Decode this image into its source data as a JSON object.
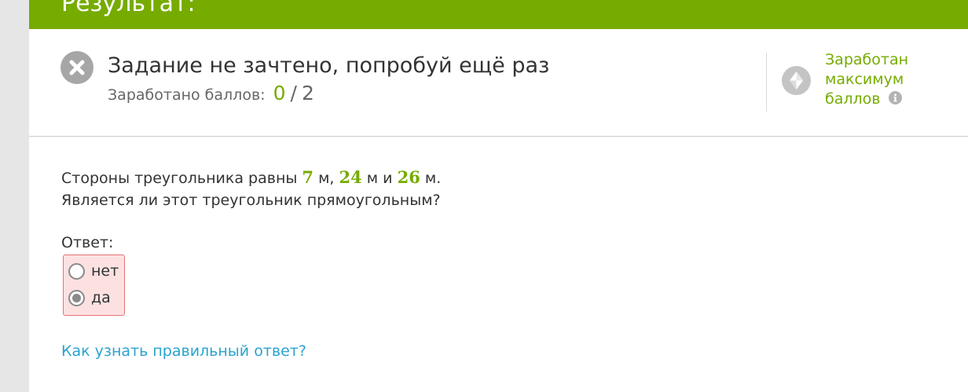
{
  "header": {
    "title": "Результат:"
  },
  "result": {
    "status_text": "Задание не зачтено, попробуй ещё раз",
    "score_label": "Заработано баллов:",
    "score_earned": "0",
    "score_separator": "/",
    "score_total": "2",
    "status_icon": "close-icon",
    "max_points": {
      "line1": "Заработан",
      "line2": "максимум",
      "line3": "баллов",
      "icon": "diamond-icon",
      "info_icon": "info-icon"
    }
  },
  "question": {
    "prefix": "Стороны треугольника равны",
    "side_a": "7",
    "unit_a": "м,",
    "side_b": "24",
    "unit_b": "м и",
    "side_c": "26",
    "unit_c": "м.",
    "line2": "Является ли этот треугольник прямоугольным?"
  },
  "answer": {
    "label": "Ответ:",
    "options": [
      {
        "label": "нет",
        "selected": false
      },
      {
        "label": "да",
        "selected": true
      }
    ]
  },
  "help_link": "Как узнать правильный ответ?",
  "colors": {
    "accent_green": "#76ab00",
    "link_blue": "#2aa3cf",
    "error_bg": "#fde1e1",
    "error_border": "#e57373"
  }
}
